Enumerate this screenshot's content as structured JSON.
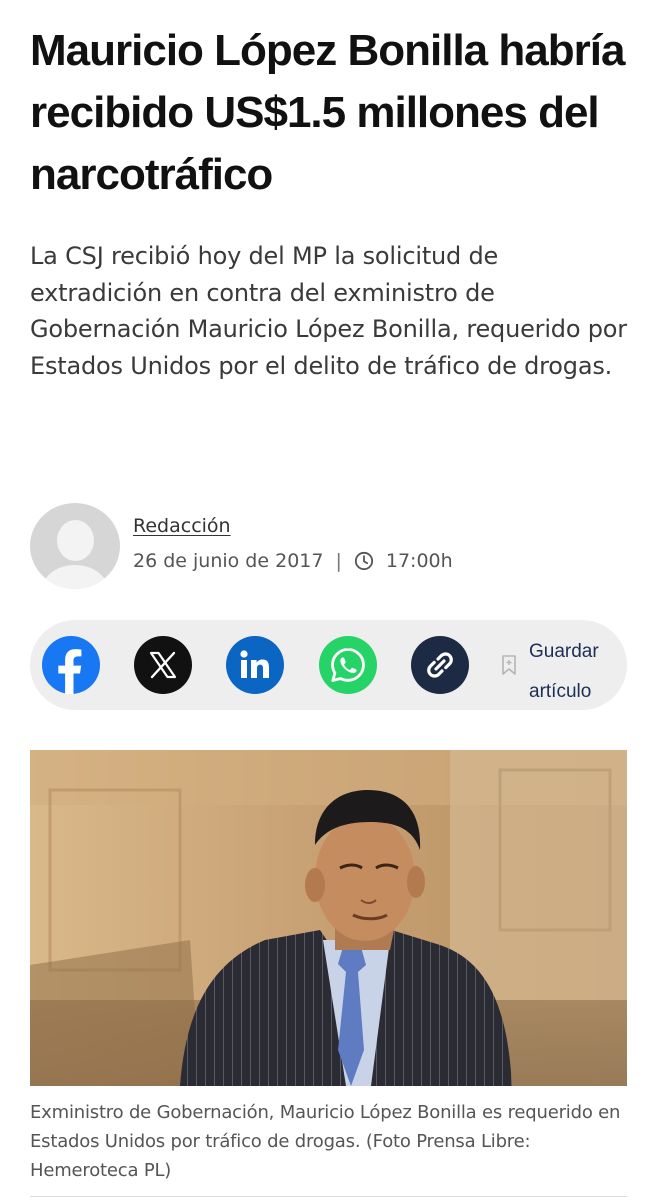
{
  "article": {
    "headline": "Mauricio López Bonilla habría recibido US$1.5 millones del narcotráfico",
    "lead": "La CSJ recibió hoy del MP la solicitud de extradición en contra del exministro de Gobernación Mauricio López Bonilla, requerido por Estados Unidos por el delito de tráfico de drogas.",
    "author": "Redacción",
    "date": "26 de junio de 2017",
    "separator": "|",
    "time": "17:00h",
    "caption": "Exministro de Gobernación, Mauricio López Bonilla es requerido en Estados Unidos por tráfico de drogas. (Foto Prensa Libre: Hemeroteca PL)"
  },
  "share": {
    "buttons": [
      {
        "name": "facebook",
        "icon": "facebook-icon",
        "color": "#1877f2"
      },
      {
        "name": "x",
        "icon": "x-icon",
        "color": "#111111"
      },
      {
        "name": "linkedin",
        "icon": "linkedin-icon",
        "color": "#0a66c2"
      },
      {
        "name": "whatsapp",
        "icon": "whatsapp-icon",
        "color": "#25d366"
      },
      {
        "name": "copy-link",
        "icon": "link-icon",
        "color": "#1d2a44"
      }
    ],
    "save_label": "Guardar artículo",
    "save_icon": "bookmark-icon",
    "bar_color": "#eeeeee",
    "save_color": "#1b2f55"
  }
}
